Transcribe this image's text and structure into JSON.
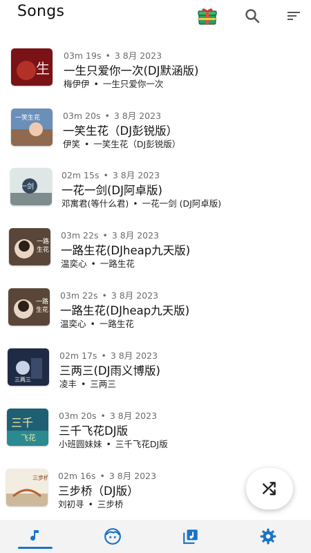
{
  "header": {
    "title": "Songs",
    "icons": [
      "gift-icon",
      "search-icon",
      "sort-icon"
    ]
  },
  "songs": [
    {
      "duration": "03m 19s",
      "date": "3 8月 2023",
      "title": "一生只爱你一次(DJ默涵版)",
      "artist": "梅伊伊",
      "album": "一生只爱你一次"
    },
    {
      "duration": "03m 20s",
      "date": "3 8月 2023",
      "title": "一笑生花（DJ彭锐版）",
      "artist": "伊笑",
      "album": "一笑生花（DJ彭锐版）"
    },
    {
      "duration": "02m 15s",
      "date": "3 8月 2023",
      "title": "一花一剑(DJ阿卓版)",
      "artist": "邓寓君(等什么君)",
      "album": "一花一剑 (DJ阿卓版)"
    },
    {
      "duration": "03m 22s",
      "date": "3 8月 2023",
      "title": "一路生花(DJheap九天版)",
      "artist": "温奕心",
      "album": "一路生花"
    },
    {
      "duration": "03m 22s",
      "date": "3 8月 2023",
      "title": "一路生花(DJheap九天版)",
      "artist": "温奕心",
      "album": "一路生花"
    },
    {
      "duration": "02m 17s",
      "date": "3 8月 2023",
      "title": "三两三(DJ雨义博版)",
      "artist": "凌丰",
      "album": "三两三"
    },
    {
      "duration": "03m 20s",
      "date": "3 8月 2023",
      "title": "三千飞花DJ版",
      "artist": "小班圆妹妹",
      "album": "三千飞花DJ版"
    },
    {
      "duration": "02m 16s",
      "date": "3 8月 2023",
      "title": "三步桥（DJ版）",
      "artist": "刘初寻",
      "album": "三步桥"
    }
  ],
  "separator": "•",
  "fab": {
    "icon": "shuffle-icon"
  },
  "bottom_nav": {
    "items": [
      "music-note-icon",
      "artist-face-icon",
      "album-icon",
      "settings-gear-icon"
    ],
    "active_index": 0,
    "accent": "#1a73c7"
  },
  "colors": {
    "accent": "#1a73c7",
    "meta_text": "#6b6b6b"
  }
}
